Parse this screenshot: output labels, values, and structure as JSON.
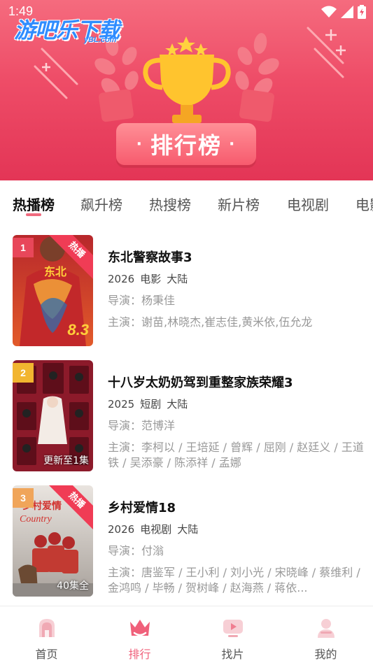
{
  "status_bar": {
    "time": "1:49"
  },
  "brand": {
    "logo_text": "游吧乐下载",
    "logo_sub": "yBL.com"
  },
  "banner": {
    "title": "排行榜"
  },
  "tabs": [
    {
      "label": "热播榜",
      "active": true
    },
    {
      "label": "飙升榜"
    },
    {
      "label": "热搜榜"
    },
    {
      "label": "新片榜"
    },
    {
      "label": "电视剧"
    },
    {
      "label": "电影"
    }
  ],
  "list": [
    {
      "rank": "1",
      "ribbon": "热播",
      "poster_score": "8.3",
      "title": "东北警察故事3",
      "year": "2026",
      "type": "电影",
      "region": "大陆",
      "director": "导演：杨秉佳",
      "cast": "主演：谢苗,林晓杰,崔志佳,黄米依,伍允龙",
      "colors": {
        "poster": "#d6412e",
        "badge": "#e8475a"
      }
    },
    {
      "rank": "2",
      "ribbon": "",
      "poster_caption": "更新至1集",
      "title": "十八岁太奶奶驾到重整家族荣耀3",
      "year": "2025",
      "type": "短剧",
      "region": "大陆",
      "director": "导演：范博洋",
      "cast": "主演：李柯以 / 王培延 / 曾辉 / 屈刚 / 赵廷义 / 王道铁 / 吴添豪 / 陈添祥 / 孟娜",
      "colors": {
        "poster": "#8c1a2a",
        "badge": "#f2b52f"
      }
    },
    {
      "rank": "3",
      "ribbon": "热播",
      "poster_caption": "40集全",
      "title": "乡村爱情18",
      "year": "2026",
      "type": "电视剧",
      "region": "大陆",
      "director": "导演：付滃",
      "cast": "主演：唐鉴军 / 王小利 / 刘小光 / 宋晓峰 / 蔡维利 / 金鸿鸣 / 毕畅 / 贺树峰 / 赵海燕 / 蒋依...",
      "colors": {
        "poster": "#c9b9a8",
        "badge": "#f0a55a"
      }
    }
  ],
  "bottom_nav": [
    {
      "label": "首页",
      "icon": "home-icon"
    },
    {
      "label": "排行",
      "icon": "crown-icon",
      "active": true
    },
    {
      "label": "找片",
      "icon": "video-icon"
    },
    {
      "label": "我的",
      "icon": "user-icon"
    }
  ],
  "colors": {
    "accent": "#f0607a",
    "banner": "#e33556"
  }
}
